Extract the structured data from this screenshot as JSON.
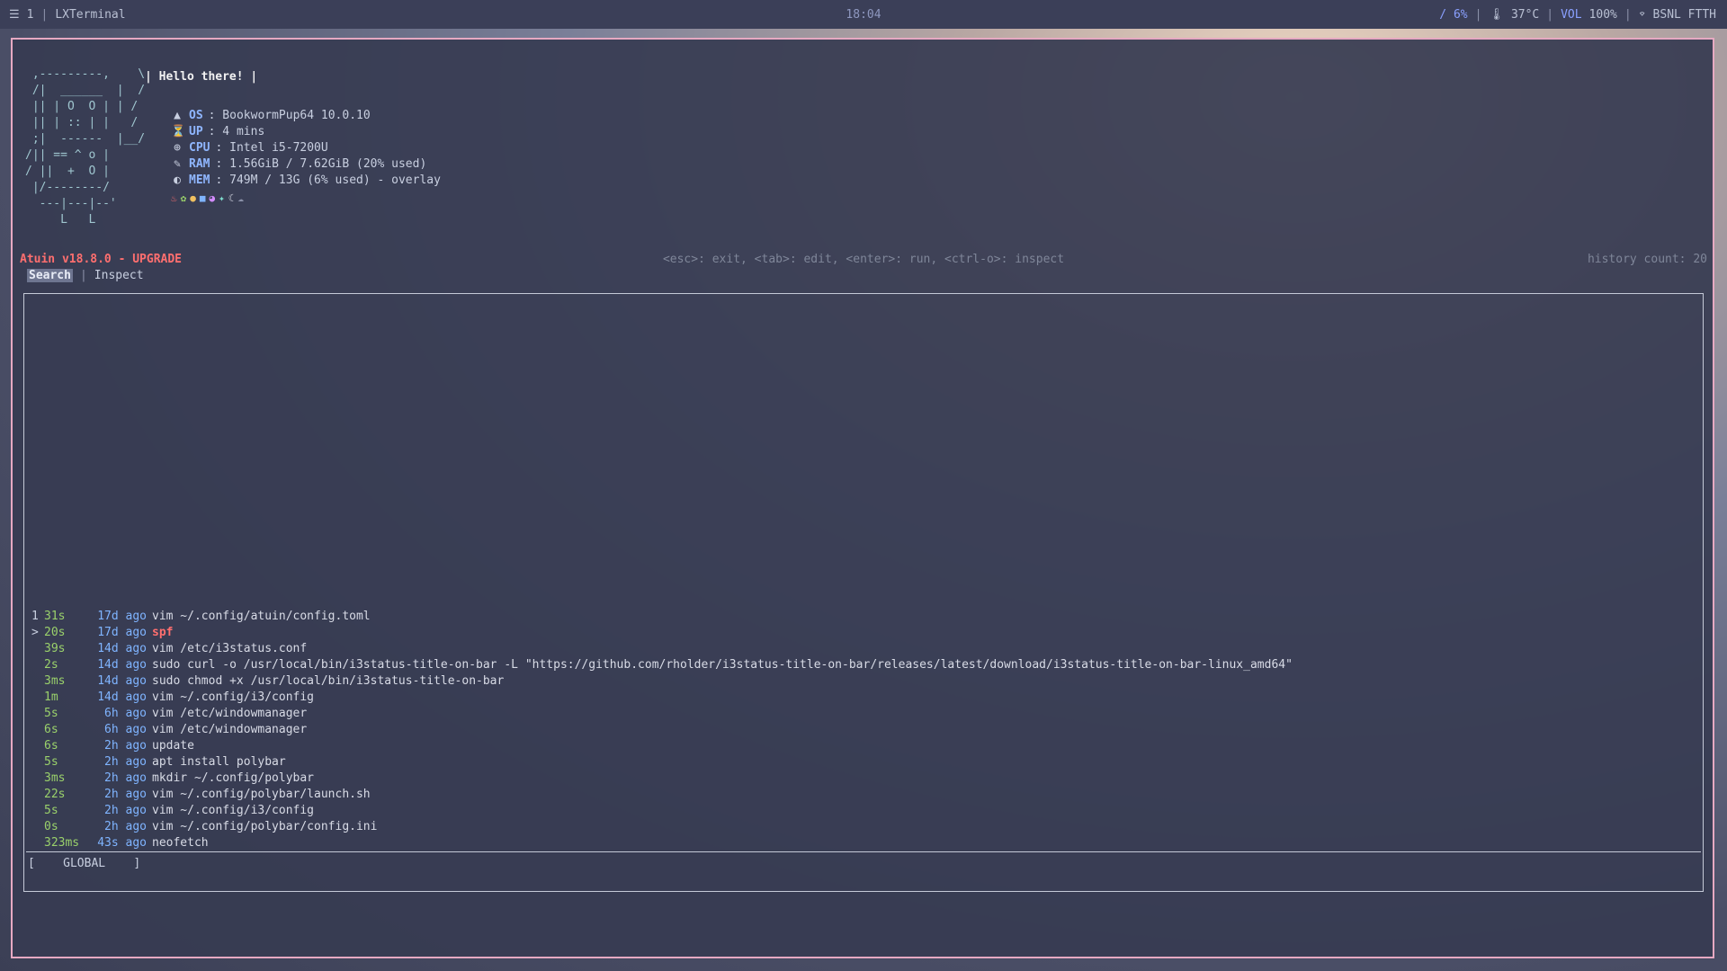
{
  "topbar": {
    "workspace": "1",
    "app_title": "LXTerminal",
    "clock": "18:04",
    "disk": "/ 6%",
    "temp": "37°C",
    "vol_label": "VOL",
    "vol_value": "100%",
    "network": "BSNL FTTH"
  },
  "fetch": {
    "greeting": "| Hello there! |",
    "ascii_art": " ,---------,    \\\n /|  ______  |  /\n || | O  O | | /\n || | :: | |   /\n ;|  ------  |__/\n/|| == ^ o |\n/ ||  +  O |\n |/--------/\n  ---|---|--'\n     L   L",
    "rows": [
      {
        "icon": "▲",
        "key": "OS",
        "value": ": BookwormPup64 10.0.10"
      },
      {
        "icon": "⏳",
        "key": "UP",
        "value": ": 4 mins"
      },
      {
        "icon": "⊕",
        "key": "CPU",
        "value": ": Intel i5-7200U"
      },
      {
        "icon": "✎",
        "key": "RAM",
        "value": ": 1.56GiB / 7.62GiB (20% used)"
      },
      {
        "icon": "◐",
        "key": "MEM",
        "value": ": 749M / 13G (6% used) - overlay"
      }
    ]
  },
  "atuin": {
    "title": "Atuin v18.8.0 - UPGRADE",
    "hints": "<esc>: exit, <tab>: edit, <enter>: run, <ctrl-o>: inspect",
    "history_count": "history count: 20",
    "tabs": [
      "Search",
      "Inspect"
    ],
    "filter": "[    GLOBAL    ]",
    "history": [
      {
        "idx": "1",
        "dur": "31s",
        "ago": "17d ago",
        "cmd": "vim ~/.config/atuin/config.toml"
      },
      {
        "idx": ">",
        "dur": "20s",
        "ago": "17d ago",
        "cmd": "spf"
      },
      {
        "idx": "",
        "dur": "39s",
        "ago": "14d ago",
        "cmd": "vim /etc/i3status.conf"
      },
      {
        "idx": "",
        "dur": "2s",
        "ago": "14d ago",
        "cmd": "sudo curl -o /usr/local/bin/i3status-title-on-bar -L \"https://github.com/rholder/i3status-title-on-bar/releases/latest/download/i3status-title-on-bar-linux_amd64\""
      },
      {
        "idx": "",
        "dur": "3ms",
        "ago": "14d ago",
        "cmd": "sudo chmod +x /usr/local/bin/i3status-title-on-bar"
      },
      {
        "idx": "",
        "dur": "1m",
        "ago": "14d ago",
        "cmd": "vim ~/.config/i3/config"
      },
      {
        "idx": "",
        "dur": "5s",
        "ago": "6h ago",
        "cmd": "vim /etc/windowmanager"
      },
      {
        "idx": "",
        "dur": "6s",
        "ago": "6h ago",
        "cmd": "vim /etc/windowmanager"
      },
      {
        "idx": "",
        "dur": "6s",
        "ago": "2h ago",
        "cmd": "update"
      },
      {
        "idx": "",
        "dur": "5s",
        "ago": "2h ago",
        "cmd": "apt install polybar"
      },
      {
        "idx": "",
        "dur": "3ms",
        "ago": "2h ago",
        "cmd": "mkdir ~/.config/polybar"
      },
      {
        "idx": "",
        "dur": "22s",
        "ago": "2h ago",
        "cmd": "vim ~/.config/polybar/launch.sh"
      },
      {
        "idx": "",
        "dur": "5s",
        "ago": "2h ago",
        "cmd": "vim ~/.config/i3/config"
      },
      {
        "idx": "",
        "dur": "0s",
        "ago": "2h ago",
        "cmd": "vim ~/.config/polybar/config.ini"
      },
      {
        "idx": "",
        "dur": "323ms",
        "ago": "43s ago",
        "cmd": "neofetch"
      }
    ]
  }
}
